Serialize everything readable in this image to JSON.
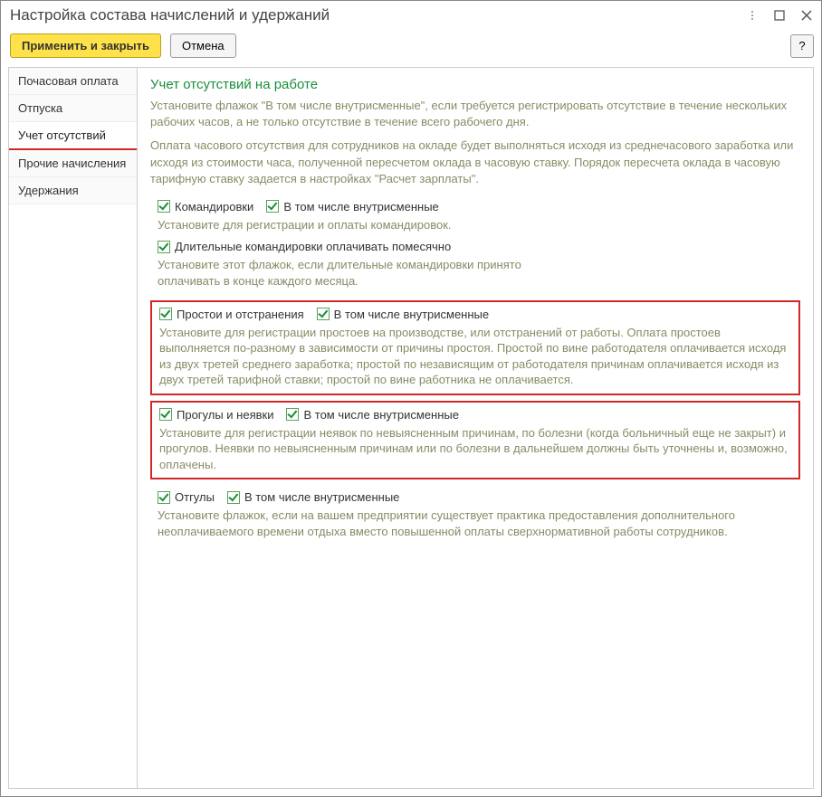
{
  "window": {
    "title": "Настройка состава начислений и удержаний"
  },
  "toolbar": {
    "apply_close": "Применить и закрыть",
    "cancel": "Отмена",
    "help": "?"
  },
  "sidebar": {
    "items": [
      {
        "label": "Почасовая оплата"
      },
      {
        "label": "Отпуска"
      },
      {
        "label": "Учет отсутствий"
      },
      {
        "label": "Прочие начисления"
      },
      {
        "label": "Удержания"
      }
    ],
    "active_index": 2
  },
  "content": {
    "heading": "Учет отсутствий на работе",
    "intro1": "Установите флажок \"В том числе внутрисменные\", если требуется регистрировать отсутствие в течение нескольких рабочих часов, а не только отсутствие в течение всего рабочего дня.",
    "intro2": "Оплата часового отсутствия для сотрудников на окладе будет выполняться исходя из среднечасового заработка или исходя из стоимости часа, полученной пересчетом оклада в часовую ставку. Порядок пересчета оклада в часовую тарифную ставку задается в настройках \"Расчет зарплаты\".",
    "g_trips": {
      "chk1": "Командировки",
      "chk2": "В том числе внутрисменные",
      "desc": "Установите для регистрации и оплаты командировок.",
      "chk3": "Длительные командировки оплачивать помесячно",
      "desc2": "Установите этот флажок, если длительные командировки принято оплачивать в конце каждого месяца."
    },
    "g_idle": {
      "chk1": "Простои и отстранения",
      "chk2": "В том числе внутрисменные",
      "desc": "Установите для регистрации простоев на производстве, или отстранений от работы. Оплата простоев выполняется по-разному в зависимости от причины простоя. Простой по вине работодателя оплачивается исходя из двух третей среднего заработка; простой по независящим от работодателя причинам оплачивается исходя из двух третей тарифной ставки; простой по вине работника не оплачивается."
    },
    "g_absence": {
      "chk1": "Прогулы и неявки",
      "chk2": "В том числе внутрисменные",
      "desc": "Установите для регистрации неявок по невыясненным причинам, по болезни (когда больничный еще не закрыт) и прогулов. Неявки по невыясненным причинам или по болезни в дальнейшем должны быть уточнены и, возможно, оплачены."
    },
    "g_dayoff": {
      "chk1": "Отгулы",
      "chk2": "В том числе внутрисменные",
      "desc": "Установите флажок, если на вашем предприятии существует практика предоставления дополнительного неоплачиваемого времени отдыха вместо повышенной оплаты сверхнормативной работы сотрудников."
    }
  }
}
